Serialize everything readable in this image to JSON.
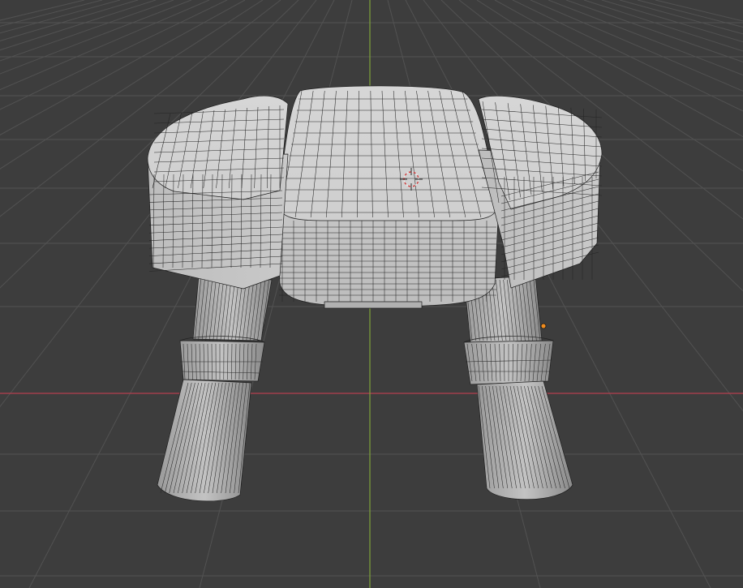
{
  "viewport": {
    "background": "#3d3d3d",
    "grid_color": "#525252",
    "x_axis_color": "#b5404f",
    "y_axis_color": "#7fa33a",
    "object_color": "#c8c8c8",
    "object_dark": "#8e8e8e",
    "wire_color": "#1c1c1c",
    "origin_color": "#f08c1e"
  },
  "icons": {
    "cursor": "3d-cursor-icon",
    "origin": "object-origin-dot"
  }
}
